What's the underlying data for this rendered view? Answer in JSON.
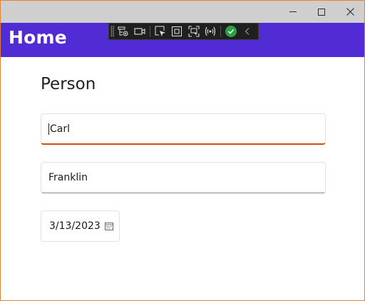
{
  "window": {
    "controls": {
      "minimize": "minimize",
      "maximize": "maximize",
      "close": "close"
    }
  },
  "header": {
    "title": "Home"
  },
  "debug_toolbar": {
    "icons": [
      "live-visual-tree-icon",
      "camera-icon",
      "select-element-icon",
      "display-layout-adorners-icon",
      "track-focus-icon",
      "hot-reload-icon",
      "check-status-icon",
      "collapse-chevron-icon"
    ]
  },
  "form": {
    "title": "Person",
    "first_name": {
      "value": "Carl"
    },
    "last_name": {
      "value": "Franklin"
    },
    "date": {
      "value": "3/13/2023",
      "icon": "calendar-icon"
    }
  },
  "colors": {
    "header_bg": "#512bd4",
    "focus_underline": "#d24e0a",
    "window_border": "#e8812a"
  }
}
